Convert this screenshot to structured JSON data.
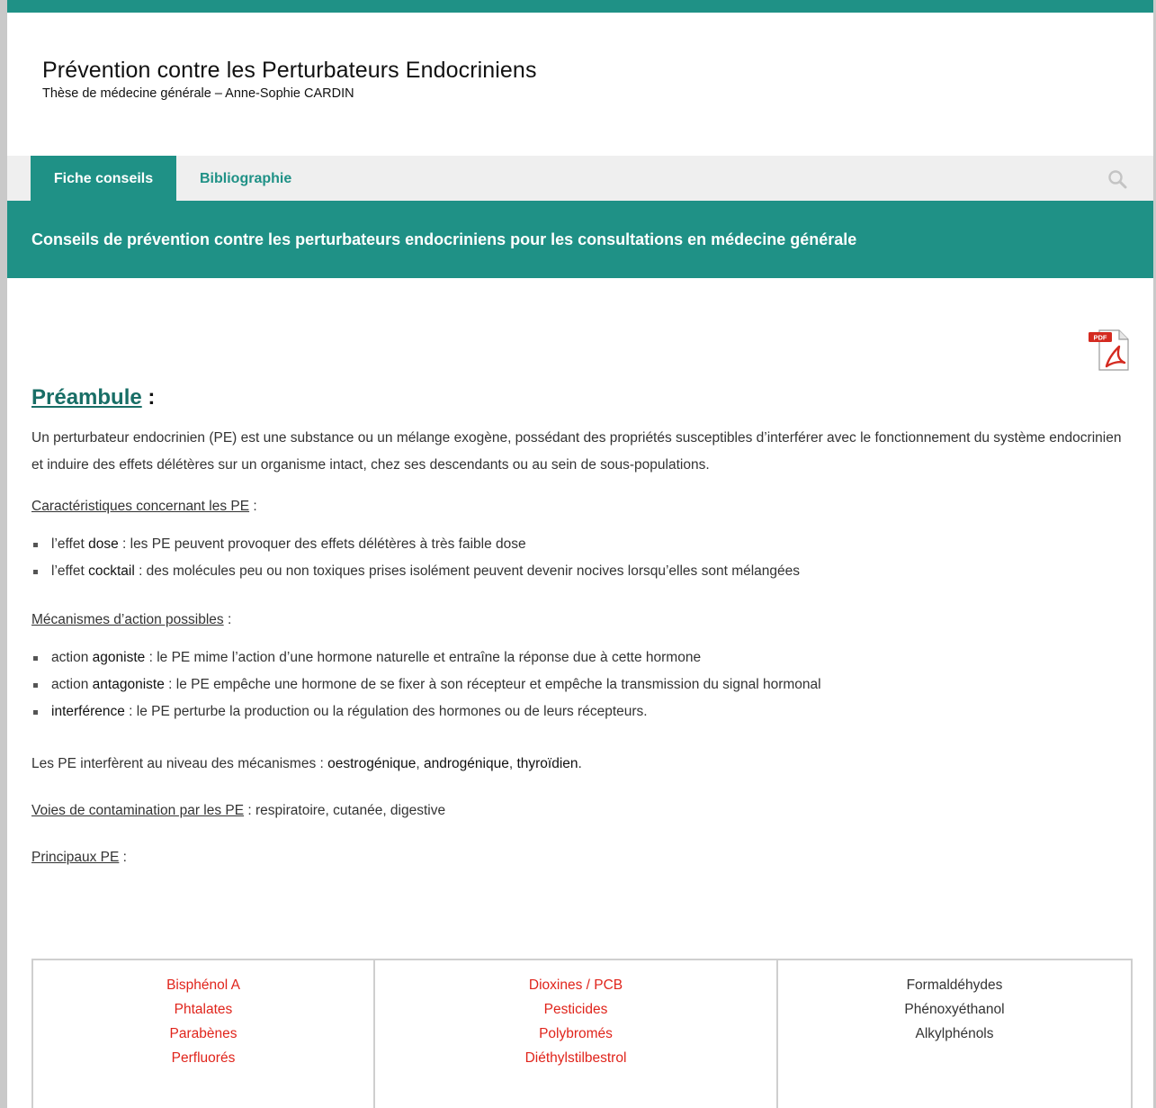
{
  "header": {
    "title": "Prévention contre les Perturbateurs Endocriniens",
    "subtitle": "Thèse de médecine générale – Anne-Sophie CARDIN"
  },
  "nav": {
    "tabs": [
      {
        "label": "Fiche conseils",
        "active": true
      },
      {
        "label": "Bibliographie",
        "active": false
      }
    ],
    "search_icon": "search-icon"
  },
  "banner": {
    "text": "Conseils de prévention contre les perturbateurs endocriniens pour les consultations en médecine générale"
  },
  "pdf_icon": {
    "label": "PDF"
  },
  "preambule": {
    "heading": "Préambule",
    "heading_suffix": " :",
    "intro": "Un perturbateur endocrinien (PE) est une substance ou un mélange exogène, possédant des propriétés susceptibles d’interférer avec le fonctionnement du système endocrinien et induire des effets délétères sur un organisme intact, chez ses descendants ou au sein de sous-populations."
  },
  "caracteristiques": {
    "heading": "Caractéristiques concernant les PE",
    "suffix": " :",
    "items": [
      {
        "pre": "l’effet ",
        "key": "dose",
        "post": " : les PE peuvent provoquer des effets délétères à très faible dose"
      },
      {
        "pre": "l’effet ",
        "key": "cocktail",
        "post": " : des molécules peu ou non toxiques prises isolément peuvent devenir nocives lorsqu’elles sont mélangées"
      }
    ]
  },
  "mecanismes": {
    "heading": "Mécanismes d’action possibles",
    "suffix": " :",
    "items": [
      {
        "pre": "action ",
        "key": "agoniste",
        "post": " : le PE mime l’action d’une hormone naturelle et entraîne la réponse due à cette hormone"
      },
      {
        "pre": "action ",
        "key": "antagoniste",
        "post": " : le PE empêche une hormone de se fixer à son récepteur et empêche la transmission du signal hormonal"
      },
      {
        "pre": "",
        "key": "interférence",
        "post": " : le PE perturbe la production ou la régulation des hormones ou de leurs récepteurs."
      }
    ]
  },
  "niveaux": {
    "pre": "Les PE interfèrent au niveau des mécanismes : ",
    "k1": "oestrogénique",
    "sep1": ", ",
    "k2": "androgénique",
    "sep2": ", ",
    "k3": "thyroïdien",
    "end": "."
  },
  "voies": {
    "heading": "Voies de contamination par les PE",
    "text": " : respiratoire, cutanée, digestive"
  },
  "principaux": {
    "heading": "Principaux PE",
    "suffix": " :",
    "columns": [
      [
        "Bisphénol A",
        "Phtalates",
        "Parabènes",
        "Perfluorés"
      ],
      [
        "Dioxines / PCB",
        "Pesticides",
        "Polybromés",
        "Diéthylstilbestrol"
      ],
      [
        "Formaldéhydes",
        "Phénoxyéthanol",
        "Alkylphénols"
      ]
    ]
  },
  "colors": {
    "accent": "#1f9186",
    "highlight_red": "#e0241b"
  }
}
